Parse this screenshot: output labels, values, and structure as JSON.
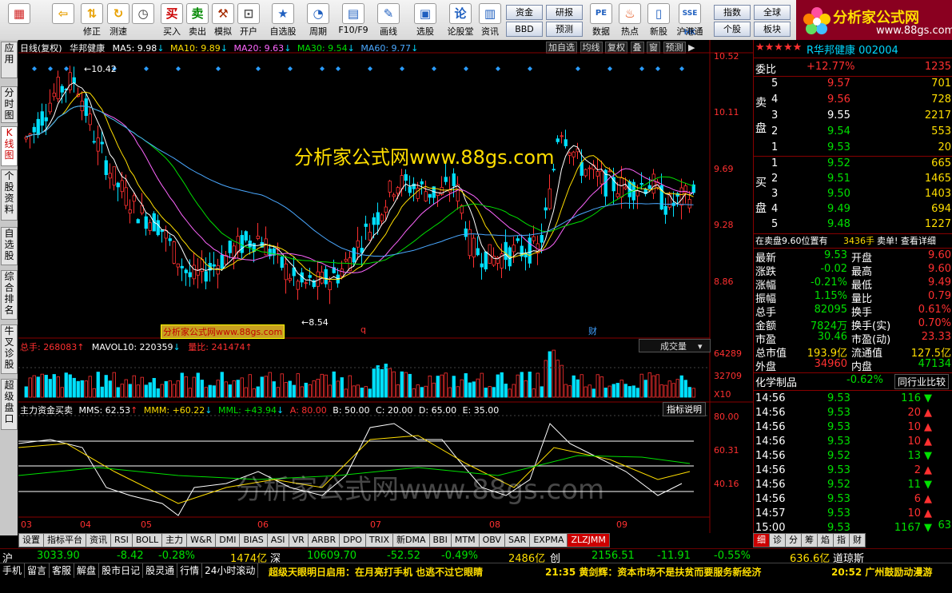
{
  "toolbar": {
    "buttons": [
      "修正",
      "测速",
      "买入",
      "卖出",
      "模拟",
      "开户",
      "自选股",
      "周期",
      "F10/F9",
      "画线",
      "选股",
      "论股堂",
      "资讯"
    ],
    "small": [
      "资金",
      "研报",
      "BBD",
      "预测"
    ],
    "icons2": [
      "数据",
      "热点",
      "新股",
      "沪港通"
    ],
    "links": [
      "指数",
      "全球",
      "个股",
      "板块"
    ]
  },
  "logo": {
    "title": "分析家公式网",
    "url": "www.88gs.com"
  },
  "left_tabs": [
    "应用",
    "分时图",
    "K线图",
    "个股资料",
    "自选股",
    "综合排名",
    "牛叉诊股",
    "超级盘口"
  ],
  "chart_header": {
    "mode": "日线(复权)",
    "stock": "华邦健康",
    "ma5": "MA5: 9.98",
    "ma10": "MA10: 9.89",
    "ma20": "MA20: 9.63",
    "ma30": "MA30: 9.54",
    "ma60": "MA60: 9.77",
    "right_btns": [
      "加自选",
      "均线",
      "复权",
      "叠",
      "窗",
      "预测"
    ]
  },
  "watermark": "分析家公式网www.88gs.com",
  "watermark2": "分析家公式网www.88gs.com",
  "label_box": "分析家公式网www.88gs.com",
  "price_axis": [
    "10.52",
    "10.11",
    "9.69",
    "9.28",
    "8.86"
  ],
  "annotations": {
    "high": "10.42",
    "low": "8.54",
    "q": "q",
    "cai": "财"
  },
  "volume": {
    "total": "总手: 268083",
    "mavol": "MAVOL10: 220359",
    "lb": "量比: 241474",
    "dropdown": "成交量",
    "axis": [
      "64289",
      "32709",
      "X10"
    ]
  },
  "indicator": {
    "title": "主力资金买卖",
    "mms": "MMS: 62.53",
    "mmm": "MMM: +60.22",
    "mml": "MML: +43.94",
    "a": "A: 80.00",
    "b": "B: 50.00",
    "c": "C: 20.00",
    "d": "D: 65.00",
    "e": "E: 35.00",
    "btn": "指标说明",
    "axis": [
      "80.00",
      "60.31",
      "40.16"
    ]
  },
  "months": [
    "03",
    "04",
    "05",
    "06",
    "07",
    "08",
    "09"
  ],
  "bottom_tabs": [
    "设置",
    "指标平台",
    "资讯",
    "RSI",
    "BOLL",
    "主力",
    "W&R",
    "DMI",
    "BIAS",
    "ASI",
    "VR",
    "ARBR",
    "DPO",
    "TRIX",
    "新DMA",
    "BBI",
    "MTM",
    "OBV",
    "SAR",
    "EXPMA",
    "ZLZJMM"
  ],
  "right_panel": {
    "stars": "★★★★★",
    "title": "R华邦健康 002004",
    "weibi_label": "委比",
    "weibi": "+12.77%",
    "weibi_v": "1235",
    "sell": [
      [
        "5",
        "9.57",
        "701"
      ],
      [
        "4",
        "9.56",
        "728"
      ],
      [
        "3",
        "9.55",
        "2217"
      ],
      [
        "2",
        "9.54",
        "553"
      ],
      [
        "1",
        "9.53",
        "20"
      ]
    ],
    "buy": [
      [
        "1",
        "9.52",
        "665"
      ],
      [
        "2",
        "9.51",
        "1465"
      ],
      [
        "3",
        "9.50",
        "1403"
      ],
      [
        "4",
        "9.49",
        "694"
      ],
      [
        "5",
        "9.48",
        "1227"
      ]
    ],
    "sell_label": [
      "卖",
      "盘"
    ],
    "buy_label": [
      "买",
      "盘"
    ],
    "pos_msg": "在卖盘9.60位置有",
    "pos_vol": "3436手",
    "pos_tail": "卖单! 查看详细",
    "stats": [
      [
        "最新",
        "9.53",
        "开盘",
        "9.60"
      ],
      [
        "涨跌",
        "-0.02",
        "最高",
        "9.60"
      ],
      [
        "涨幅",
        "-0.21%",
        "最低",
        "9.49"
      ],
      [
        "振幅",
        "1.15%",
        "量比",
        "0.79"
      ],
      [
        "总手",
        "82095",
        "换手",
        "0.61%"
      ],
      [
        "金额",
        "7824万",
        "换手(实)",
        "0.70%"
      ],
      [
        "市盈",
        "30.46",
        "市盈(动)",
        "23.33"
      ],
      [
        "总市值",
        "193.9亿",
        "流通值",
        "127.5亿"
      ],
      [
        "外盘",
        "34960",
        "内盘",
        "47134"
      ]
    ],
    "industry": "化学制品",
    "industry_pct": "-0.62%",
    "compare": "同行业比较",
    "ticks": [
      [
        "14:56",
        "9.53",
        "116",
        "down"
      ],
      [
        "14:56",
        "9.53",
        "20",
        "up"
      ],
      [
        "14:56",
        "9.53",
        "10",
        "up"
      ],
      [
        "14:56",
        "9.53",
        "10",
        "up"
      ],
      [
        "14:56",
        "9.52",
        "13",
        "down"
      ],
      [
        "14:56",
        "9.53",
        "2",
        "up"
      ],
      [
        "14:56",
        "9.52",
        "11",
        "down"
      ],
      [
        "14:56",
        "9.53",
        "6",
        "up"
      ],
      [
        "14:57",
        "9.53",
        "10",
        "up"
      ],
      [
        "15:00",
        "9.53",
        "1167",
        "down"
      ]
    ],
    "last_tail": "63",
    "tabs": [
      "细",
      "诊",
      "分",
      "筹",
      "焰",
      "指",
      "财"
    ]
  },
  "index_bar": [
    {
      "name": "沪",
      "val": "3033.90",
      "chg": "-8.42",
      "pct": "-0.28%",
      "amt": "1474亿"
    },
    {
      "name": "深",
      "val": "10609.70",
      "chg": "-52.52",
      "pct": "-0.49%",
      "amt": "2486亿"
    },
    {
      "name": "创",
      "val": "2156.51",
      "chg": "-11.91",
      "pct": "-0.55%",
      "amt": "636.6亿"
    }
  ],
  "index_tail": "道琼斯",
  "news_btns": [
    "手机",
    "留言",
    "客服",
    "解盘",
    "股市日记",
    "股灵通",
    "行情",
    "24小时滚动"
  ],
  "news": [
    "超级天眼明日启用：在月亮打手机 也逃不过它眼睛",
    "21:35 黄剑辉：资本市场不是扶贫而要服务新经济",
    "20:52 广州鼓励动漫游"
  ],
  "colors": {
    "bg": "#000000",
    "up": "#ff3030",
    "down": "#00e0ff",
    "ma5": "#ffffff",
    "ma10": "#ffde00",
    "ma20": "#ff66ff",
    "ma30": "#00e000",
    "ma60": "#4aa8ff"
  }
}
